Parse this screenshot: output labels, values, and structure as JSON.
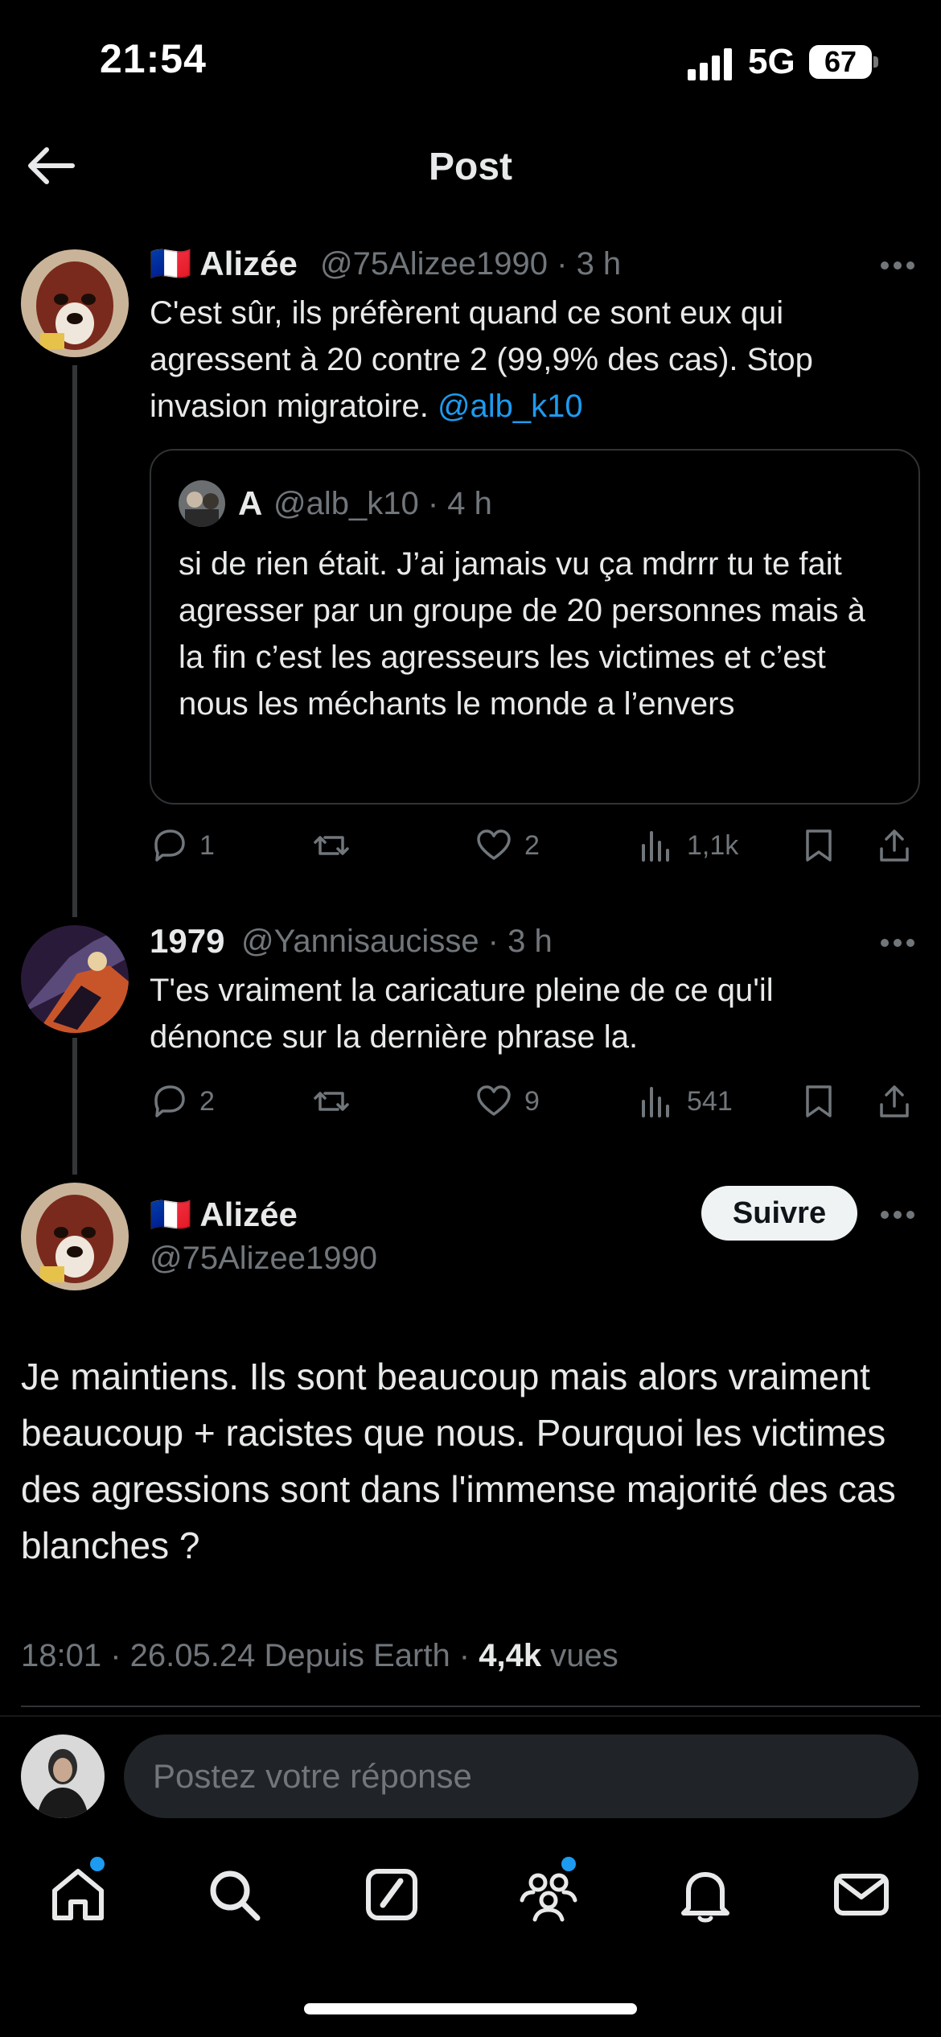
{
  "status_bar": {
    "time": "21:54",
    "network": "5G",
    "battery": "67"
  },
  "header": {
    "title": "Post"
  },
  "tweet1": {
    "flag": "🇫🇷",
    "name": "Alizée",
    "handle": "@75Alizee1990 · 3 h",
    "text_a": "C'est sûr, ils préfèrent quand ce sont eux qui agressent à 20 contre 2 (99,9% des cas). Stop invasion migratoire. ",
    "mention": "@alb_k10",
    "quote": {
      "name": "A",
      "handle": "@alb_k10 · 4 h",
      "text": "si de rien était. J’ai jamais vu ça mdrrr tu te fait agresser par un groupe de 20 personnes mais à la fin c’est les agresseurs les victimes et c’est nous les méchants le monde a l’envers"
    },
    "actions": {
      "replies": "1",
      "retweets": "",
      "likes": "2",
      "views": "1,1k"
    }
  },
  "tweet2": {
    "name": "1979",
    "handle": "@Yannisaucisse · 3 h",
    "text": "T'es vraiment la caricature pleine de ce qu'il dénonce sur la dernière phrase la.",
    "actions": {
      "replies": "2",
      "retweets": "",
      "likes": "9",
      "views": "541"
    }
  },
  "main_tweet": {
    "flag": "🇫🇷",
    "name": "Alizée",
    "handle": "@75Alizee1990",
    "follow_label": "Suivre",
    "text": "Je maintiens. Ils sont beaucoup mais alors vraiment beaucoup + racistes que nous. Pourquoi les victimes des agressions sont dans l'immense majorité des cas blanches ?",
    "meta_prefix": "18:01 · 26.05.24 Depuis Earth · ",
    "views_count": "4,4k",
    "views_label": " vues"
  },
  "reply_bar": {
    "placeholder": "Postez votre réponse"
  },
  "nav": {
    "items": [
      "home-icon",
      "search-icon",
      "compose-icon",
      "communities-icon",
      "notifications-icon",
      "messages-icon"
    ]
  },
  "colors": {
    "accent": "#1d9bf0",
    "background": "#000000",
    "muted": "#71767b"
  }
}
